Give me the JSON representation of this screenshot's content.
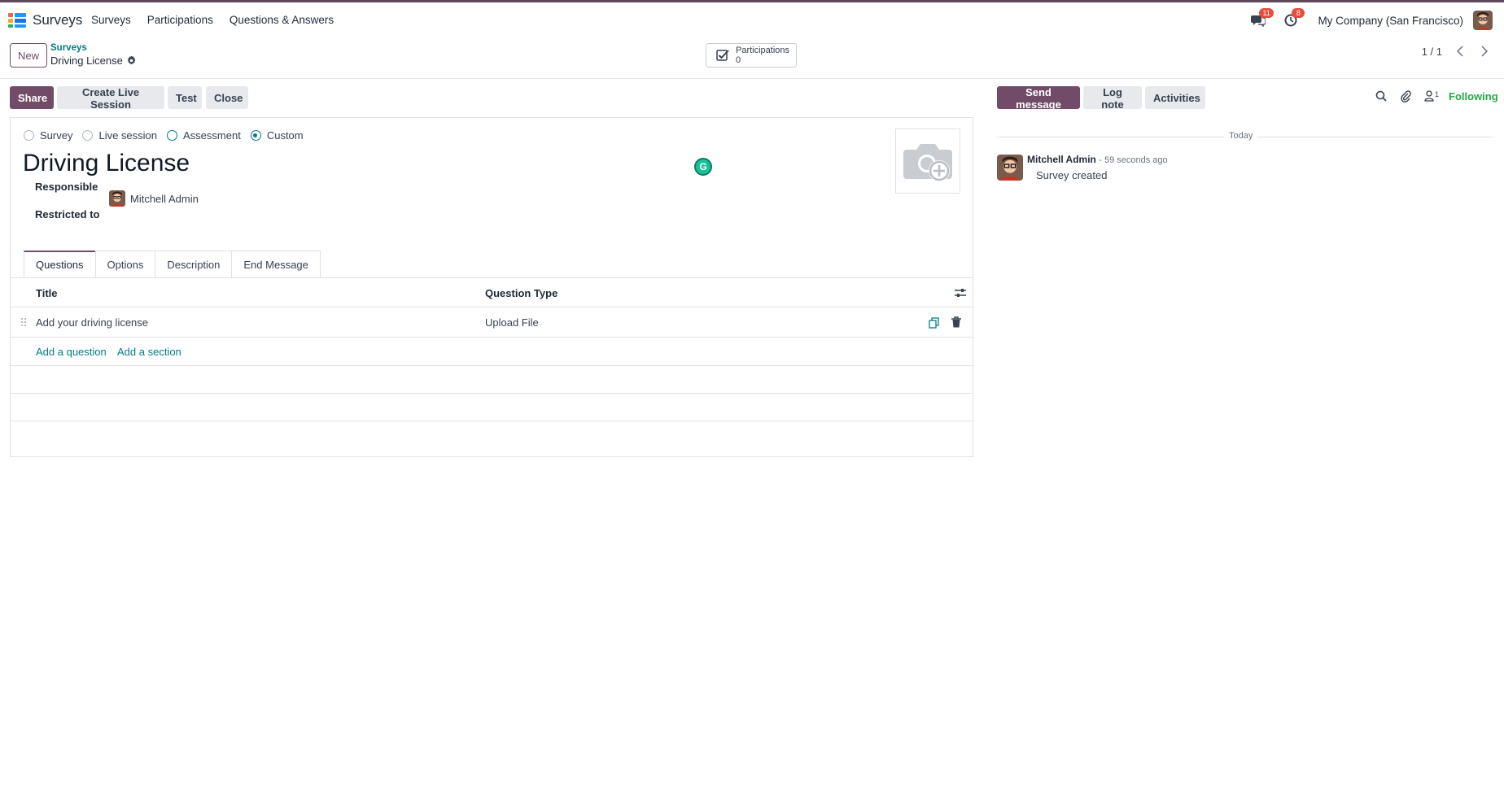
{
  "navbar": {
    "app_name": "Surveys",
    "menu": [
      "Surveys",
      "Participations",
      "Questions & Answers"
    ],
    "messages_count": "11",
    "activities_count": "8",
    "company": "My Company (San Francisco)"
  },
  "control_panel": {
    "new_label": "New",
    "breadcrumb_parent": "Surveys",
    "breadcrumb_current": "Driving License",
    "stat_label": "Participations",
    "stat_value": "0",
    "pager": "1 / 1"
  },
  "status_buttons": {
    "share": "Share",
    "live_session": "Create Live Session",
    "test": "Test",
    "close": "Close"
  },
  "form": {
    "survey_types": [
      {
        "label": "Survey",
        "checked": false
      },
      {
        "label": "Live session",
        "checked": false
      },
      {
        "label": "Assessment",
        "checked": false
      },
      {
        "label": "Custom",
        "checked": true
      }
    ],
    "title": "Driving License",
    "responsible_label": "Responsible",
    "responsible_value": "Mitchell Admin",
    "restricted_label": "Restricted to",
    "tabs": [
      "Questions",
      "Options",
      "Description",
      "End Message"
    ],
    "columns": [
      "Title",
      "Question Type"
    ],
    "rows": [
      {
        "title": "Add your driving license",
        "type": "Upload File"
      }
    ],
    "add_question": "Add a question",
    "add_section": "Add a section"
  },
  "chatter": {
    "send_message": "Send message",
    "log_note": "Log note",
    "activities": "Activities",
    "followers_count": "1",
    "following": "Following",
    "date_separator": "Today",
    "message": {
      "author": "Mitchell Admin",
      "time": "- 59 seconds ago",
      "body": "Survey created"
    }
  },
  "colors": {
    "brand": "#714b67",
    "link": "#017e84",
    "following": "#28a745",
    "badge": "#e74c3c"
  }
}
